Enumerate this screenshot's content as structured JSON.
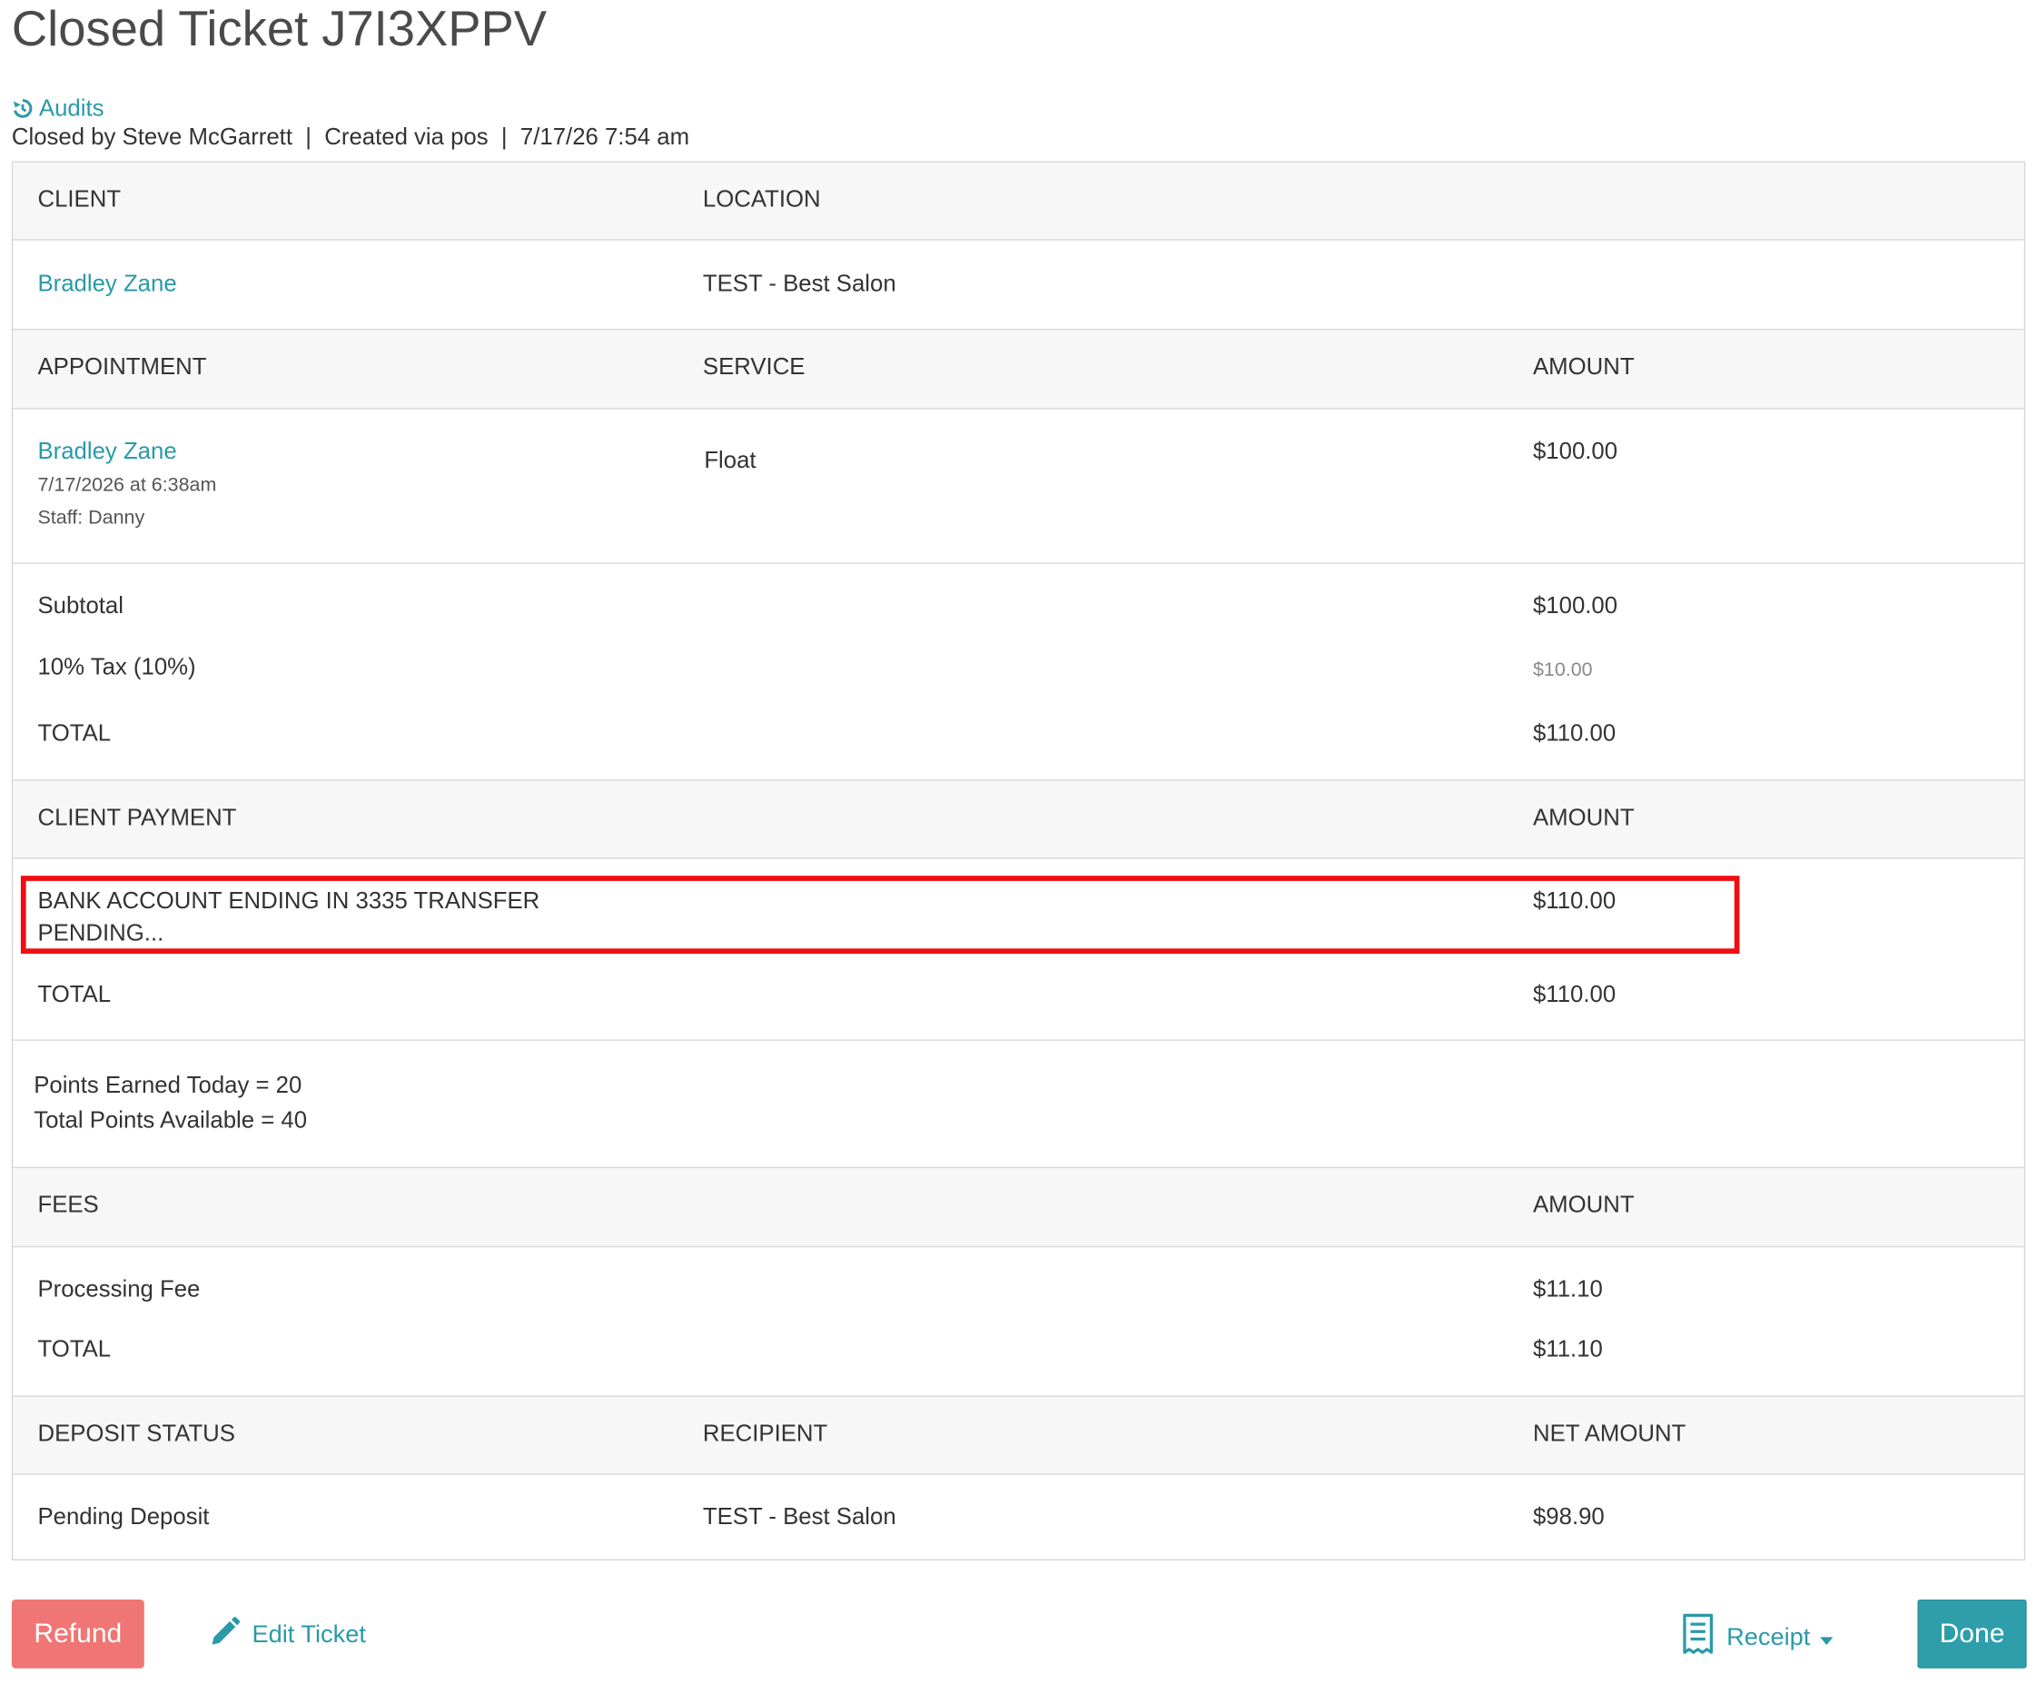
{
  "page": {
    "title": "Closed Ticket J7I3XPPV",
    "audits_label": "Audits",
    "meta": "Closed by Steve McGarrett  |  Created via pos  |  7/17/26 7:54 am"
  },
  "client_section": {
    "headers": {
      "client": "CLIENT",
      "location": "LOCATION"
    },
    "client_name": "Bradley Zane",
    "location": "TEST - Best Salon"
  },
  "appointment_section": {
    "headers": {
      "appointment": "APPOINTMENT",
      "service": "SERVICE",
      "amount": "AMOUNT"
    },
    "client_name": "Bradley Zane",
    "datetime": "7/17/2026 at 6:38am",
    "staff": "Staff: Danny",
    "service": "Float",
    "amount": "$100.00"
  },
  "totals": {
    "subtotal_label": "Subtotal",
    "subtotal_value": "$100.00",
    "tax_label": "10% Tax (10%)",
    "tax_value": "$10.00",
    "total_label": "TOTAL",
    "total_value": "$110.00"
  },
  "payment_section": {
    "headers": {
      "client_payment": "CLIENT PAYMENT",
      "amount": "AMOUNT"
    },
    "method_line1": "BANK ACCOUNT ENDING IN 3335 TRANSFER",
    "method_line2": "PENDING...",
    "method_amount": "$110.00",
    "total_label": "TOTAL",
    "total_value": "$110.00"
  },
  "points": {
    "earned_today": "Points Earned Today = 20",
    "total_available": "Total Points Available = 40"
  },
  "fees_section": {
    "headers": {
      "fees": "FEES",
      "amount": "AMOUNT"
    },
    "processing_label": "Processing Fee",
    "processing_value": "$11.10",
    "total_label": "TOTAL",
    "total_value": "$11.10"
  },
  "deposit_section": {
    "headers": {
      "deposit_status": "DEPOSIT STATUS",
      "recipient": "RECIPIENT",
      "net_amount": "NET AMOUNT"
    },
    "status": "Pending Deposit",
    "recipient": "TEST - Best Salon",
    "net_amount": "$98.90"
  },
  "actions": {
    "refund_label": "Refund",
    "edit_label": "Edit Ticket",
    "receipt_label": "Receipt",
    "done_label": "Done"
  },
  "colors": {
    "link": "#2a9aa8",
    "refund": "#ef7674",
    "done": "#2e9eab",
    "highlight": "#ef0d12"
  },
  "icons": {
    "audits": "history-icon",
    "edit": "pencil-icon",
    "receipt": "receipt-icon",
    "receipt_caret": "caret-down-icon"
  }
}
